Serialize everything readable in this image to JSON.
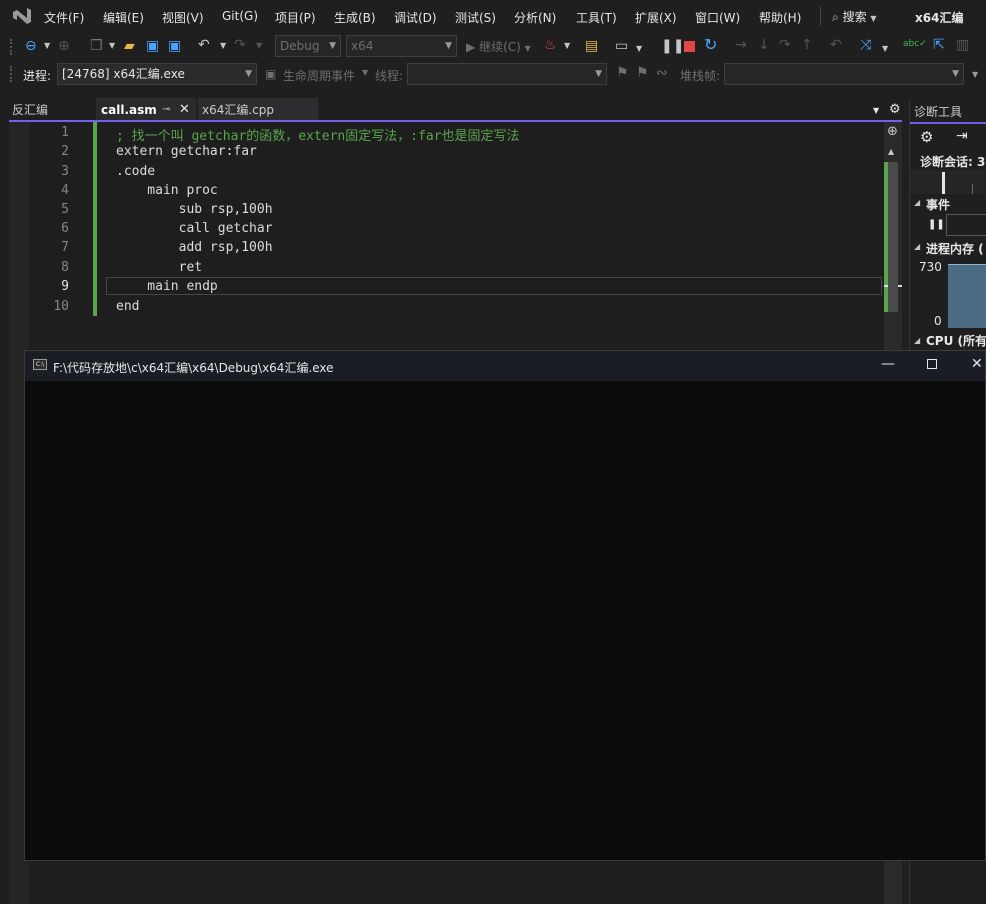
{
  "menubar": {
    "items": [
      "文件(F)",
      "编辑(E)",
      "视图(V)",
      "Git(G)",
      "项目(P)",
      "生成(B)",
      "调试(D)",
      "测试(S)",
      "分析(N)",
      "工具(T)",
      "扩展(X)",
      "窗口(W)",
      "帮助(H)"
    ],
    "search_label": "搜索",
    "solution_name": "x64汇编"
  },
  "toolbar": {
    "config": "Debug",
    "platform": "x64",
    "continue_label": "继续(C)",
    "process_label": "进程:",
    "process_value": "[24768] x64汇编.exe",
    "lifecycle_label": "生命周期事件",
    "thread_label": "线程:",
    "stackframe_label": "堆栈帧:"
  },
  "tabs": {
    "disasm": "反汇编",
    "active": "call.asm",
    "other": "x64汇编.cpp"
  },
  "editor": {
    "lines": [
      {
        "n": "1",
        "text": "; 找一个叫 getchar的函数，extern固定写法，:far也是固定写法"
      },
      {
        "n": "2",
        "text": "extern getchar:far"
      },
      {
        "n": "3",
        "text": ".code"
      },
      {
        "n": "4",
        "text": "    main proc"
      },
      {
        "n": "5",
        "text": "        sub rsp,100h"
      },
      {
        "n": "6",
        "text": "        call getchar"
      },
      {
        "n": "7",
        "text": "        add rsp,100h"
      },
      {
        "n": "8",
        "text": "        ret"
      },
      {
        "n": "9",
        "text": "    main endp"
      },
      {
        "n": "10",
        "text": "end"
      }
    ]
  },
  "diagnostics": {
    "title": "诊断工具",
    "session": "诊断会话: 3",
    "events": "事件",
    "memory": "进程内存 (",
    "mem_max": "730",
    "mem_min": "0",
    "cpu": "CPU (所有"
  },
  "console": {
    "title": "F:\\代码存放地\\c\\x64汇编\\x64\\Debug\\x64汇编.exe"
  },
  "colors": {
    "accent": "#7160e8",
    "changed_bar": "#57a64a",
    "console_bg": "#0c0c0c"
  }
}
